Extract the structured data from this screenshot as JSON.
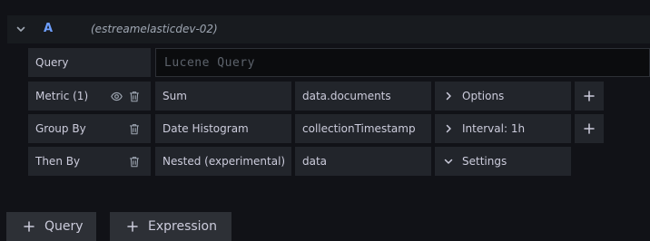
{
  "query": {
    "ref_id": "A",
    "datasource": "(estreamelasticdev-02)",
    "query_label": "Query",
    "query_placeholder": "Lucene Query"
  },
  "rows": {
    "metric": {
      "label": "Metric (1)",
      "type": "Sum",
      "field": "data.documents",
      "options": "Options"
    },
    "group_by": {
      "label": "Group By",
      "type": "Date Histogram",
      "field": "collectionTimestamp",
      "options": "Interval: 1h"
    },
    "then_by": {
      "label": "Then By",
      "type": "Nested (experimental)",
      "field": "data",
      "options": "Settings"
    }
  },
  "footer": {
    "add_query": "Query",
    "add_expression": "Expression"
  },
  "icons": {
    "collapse": "chevron-down-icon",
    "eye": "eye-icon",
    "trash": "trash-icon",
    "plus": "plus-icon",
    "chevron_right": "chevron-right-icon",
    "chevron_down": "chevron-down-icon"
  },
  "colors": {
    "background": "#111217",
    "row_header": "#181b1f",
    "cell": "#22252b",
    "input": "#0b0c0e",
    "button": "#2d3036",
    "ref_id": "#6e9fff",
    "text": "#ccccdc"
  }
}
